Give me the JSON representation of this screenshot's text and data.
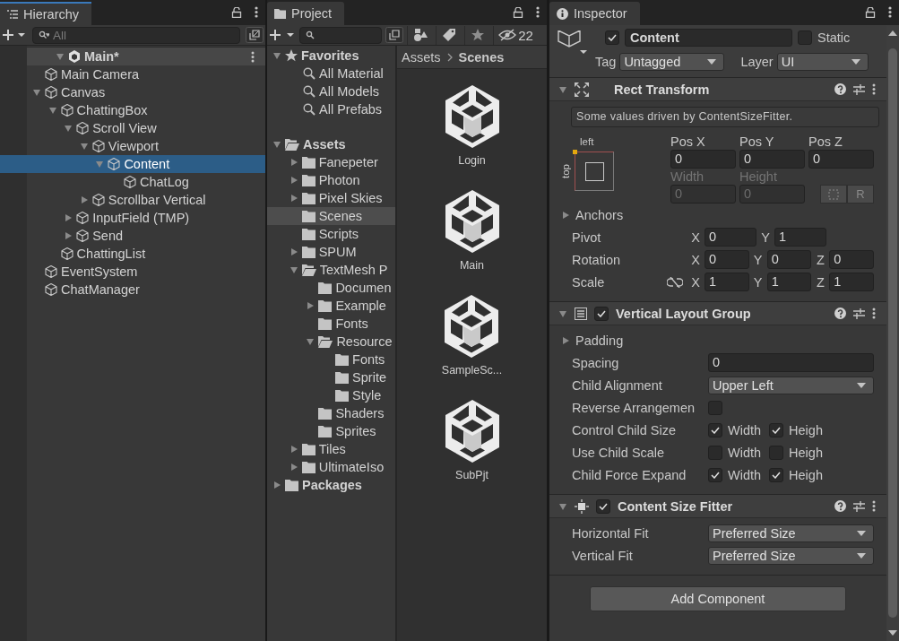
{
  "hierarchy": {
    "tab": "Hierarchy",
    "search_placeholder": "All",
    "scene": {
      "name": "Main*",
      "expanded": true,
      "selected": false,
      "children": [
        {
          "name": "Main Camera",
          "selected": false
        },
        {
          "name": "Canvas",
          "expanded": true,
          "selected": false,
          "children": [
            {
              "name": "ChattingBox",
              "expanded": true,
              "selected": false,
              "children": [
                {
                  "name": "Scroll View",
                  "expanded": true,
                  "selected": false,
                  "children": [
                    {
                      "name": "Viewport",
                      "expanded": true,
                      "selected": false,
                      "children": [
                        {
                          "name": "Content",
                          "expanded": true,
                          "selected": true,
                          "children": [
                            {
                              "name": "ChatLog",
                              "selected": false
                            }
                          ]
                        }
                      ]
                    },
                    {
                      "name": "Scrollbar Vertical",
                      "expanded": false,
                      "selected": false
                    }
                  ]
                },
                {
                  "name": "InputField (TMP)",
                  "expanded": false,
                  "selected": false
                },
                {
                  "name": "Send",
                  "expanded": false,
                  "selected": false
                }
              ]
            },
            {
              "name": "ChattingList",
              "selected": false
            }
          ]
        },
        {
          "name": "EventSystem",
          "selected": false
        },
        {
          "name": "ChatManager",
          "selected": false
        }
      ]
    }
  },
  "project": {
    "tab": "Project",
    "hidden_count": "22",
    "favorites": {
      "name": "Favorites",
      "expanded": true,
      "items": [
        {
          "name": "All Material",
          "selected": false
        },
        {
          "name": "All Models",
          "selected": false
        },
        {
          "name": "All Prefabs",
          "selected": false
        }
      ]
    },
    "tree": [
      {
        "name": "Assets",
        "expanded": true,
        "selected": false,
        "children": [
          {
            "name": "Fanepeter",
            "expanded": false,
            "selected": false
          },
          {
            "name": "Photon",
            "expanded": false,
            "selected": false
          },
          {
            "name": "Pixel Skies",
            "expanded": false,
            "selected": false
          },
          {
            "name": "Scenes",
            "selected": true
          },
          {
            "name": "Scripts",
            "selected": false
          },
          {
            "name": "SPUM",
            "expanded": false,
            "selected": false
          },
          {
            "name": "TextMesh P",
            "expanded": true,
            "selected": false,
            "children": [
              {
                "name": "Documen",
                "selected": false
              },
              {
                "name": "Example",
                "expanded": false,
                "selected": false
              },
              {
                "name": "Fonts",
                "selected": false
              },
              {
                "name": "Resource",
                "expanded": true,
                "selected": false,
                "children": [
                  {
                    "name": "Fonts",
                    "selected": false
                  },
                  {
                    "name": "Sprite",
                    "selected": false
                  },
                  {
                    "name": "Style",
                    "selected": false
                  }
                ]
              },
              {
                "name": "Shaders",
                "selected": false
              },
              {
                "name": "Sprites",
                "selected": false
              }
            ]
          },
          {
            "name": "Tiles",
            "expanded": false,
            "selected": false
          },
          {
            "name": "UltimateIso",
            "expanded": false,
            "selected": false
          }
        ]
      },
      {
        "name": "Packages",
        "expanded": false,
        "selected": false
      }
    ],
    "breadcrumb": [
      "Assets",
      "Scenes"
    ],
    "assets": [
      {
        "name": "Login"
      },
      {
        "name": "Main"
      },
      {
        "name": "SampleSc..."
      },
      {
        "name": "SubPjt"
      }
    ]
  },
  "inspector": {
    "tab": "Inspector",
    "object_name": "Content",
    "active": true,
    "static_label": "Static",
    "static": false,
    "tag_label": "Tag",
    "tag": "Untagged",
    "layer_label": "Layer",
    "layer": "UI",
    "components": [
      {
        "kind": "rect_transform",
        "title": "Rect Transform",
        "expanded": true,
        "note": "Some values driven by ContentSizeFitter.",
        "anchor_h": "left",
        "anchor_v": "top",
        "pos_fields": [
          {
            "label": "Pos X",
            "value": "0",
            "disabled": false
          },
          {
            "label": "Pos Y",
            "value": "0",
            "disabled": false
          },
          {
            "label": "Pos Z",
            "value": "0",
            "disabled": false
          }
        ],
        "size_fields": [
          {
            "label": "Width",
            "value": "0",
            "disabled": true
          },
          {
            "label": "Height",
            "value": "0",
            "disabled": true
          }
        ],
        "raw_label": "R",
        "rows": [
          {
            "kind": "foldout",
            "label": "Anchors",
            "expanded": false
          },
          {
            "kind": "vector",
            "label": "Pivot",
            "fields": [
              {
                "axis": "X",
                "value": "0"
              },
              {
                "axis": "Y",
                "value": "1"
              }
            ]
          },
          {
            "kind": "vector",
            "label": "Rotation",
            "fields": [
              {
                "axis": "X",
                "value": "0"
              },
              {
                "axis": "Y",
                "value": "0"
              },
              {
                "axis": "Z",
                "value": "0"
              }
            ]
          },
          {
            "kind": "vector",
            "label": "Scale",
            "constrained": false,
            "fields": [
              {
                "axis": "X",
                "value": "1"
              },
              {
                "axis": "Y",
                "value": "1"
              },
              {
                "axis": "Z",
                "value": "1"
              }
            ]
          }
        ]
      },
      {
        "kind": "layout_group",
        "title": "Vertical Layout Group",
        "expanded": true,
        "enabled": true,
        "rows": [
          {
            "kind": "foldout",
            "label": "Padding",
            "expanded": false
          },
          {
            "kind": "field",
            "label": "Spacing",
            "value": "0"
          },
          {
            "kind": "dropdown",
            "label": "Child Alignment",
            "value": "Upper Left"
          },
          {
            "kind": "checkbox",
            "label": "Reverse Arrangemen",
            "checked": false
          },
          {
            "kind": "pair",
            "label": "Control Child Size",
            "options": [
              {
                "label": "Width",
                "checked": true
              },
              {
                "label": "Heigh",
                "checked": true
              }
            ]
          },
          {
            "kind": "pair",
            "label": "Use Child Scale",
            "options": [
              {
                "label": "Width",
                "checked": false
              },
              {
                "label": "Heigh",
                "checked": false
              }
            ]
          },
          {
            "kind": "pair",
            "label": "Child Force Expand",
            "options": [
              {
                "label": "Width",
                "checked": true
              },
              {
                "label": "Heigh",
                "checked": true
              }
            ]
          }
        ]
      },
      {
        "kind": "size_fitter",
        "title": "Content Size Fitter",
        "expanded": true,
        "enabled": true,
        "rows": [
          {
            "kind": "dropdown",
            "label": "Horizontal Fit",
            "value": "Preferred Size"
          },
          {
            "kind": "dropdown",
            "label": "Vertical Fit",
            "value": "Preferred Size"
          }
        ]
      }
    ],
    "add_component": "Add Component"
  }
}
